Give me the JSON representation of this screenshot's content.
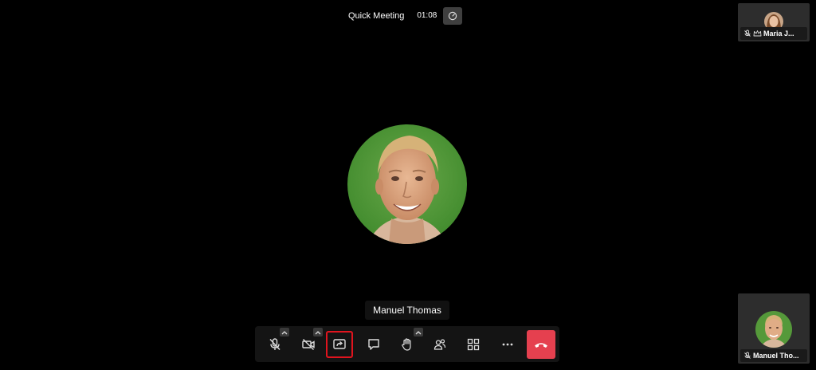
{
  "header": {
    "title": "Quick Meeting",
    "timer": "01:08"
  },
  "main": {
    "speaker_name": "Manuel Thomas"
  },
  "thumbnails": [
    {
      "name": "Maria J...",
      "icons": [
        "mic-muted-icon",
        "moderator-crown-icon"
      ]
    },
    {
      "name": "Manuel Tho...",
      "icons": [
        "mic-muted-icon"
      ]
    }
  ],
  "toolbar": {
    "buttons": [
      "mic-muted",
      "camera-off",
      "screen-share",
      "chat",
      "raise-hand",
      "participants",
      "tile-view",
      "more",
      "hang-up"
    ],
    "highlighted": "screen-share"
  },
  "colors": {
    "background": "#000000",
    "hangup": "#e5404f",
    "highlight": "#e0141e",
    "panel": "#2d2d2d"
  }
}
